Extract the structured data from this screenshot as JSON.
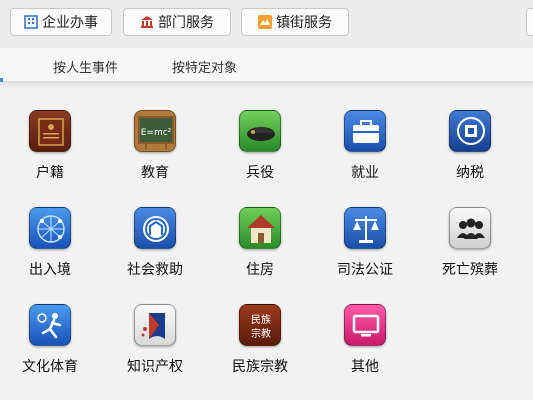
{
  "topbar": {
    "buttons": [
      {
        "label": "企业办事",
        "icon": "building-icon"
      },
      {
        "label": "部门服务",
        "icon": "government-icon"
      },
      {
        "label": "镇街服务",
        "icon": "town-icon"
      }
    ]
  },
  "tabs": [
    {
      "label": "按人生事件"
    },
    {
      "label": "按特定对象"
    }
  ],
  "grid": {
    "items": [
      {
        "label": "户籍",
        "icon": "household-register-icon",
        "color": "#6b2a1c"
      },
      {
        "label": "教育",
        "icon": "blackboard-icon",
        "color": "#3b5d3a"
      },
      {
        "label": "兵役",
        "icon": "military-beret-icon",
        "color": "#3da33a"
      },
      {
        "label": "就业",
        "icon": "briefcase-icon",
        "color": "#1f62c6"
      },
      {
        "label": "纳税",
        "icon": "tax-emblem-icon",
        "color": "#1e55b0"
      },
      {
        "label": "出入境",
        "icon": "globe-network-icon",
        "color": "#2b73d6"
      },
      {
        "label": "社会救助",
        "icon": "social-aid-icon",
        "color": "#2468c8"
      },
      {
        "label": "住房",
        "icon": "house-icon",
        "color": "#3aa03a"
      },
      {
        "label": "司法公证",
        "icon": "scales-icon",
        "color": "#1f62c6"
      },
      {
        "label": "死亡殡葬",
        "icon": "mourning-people-icon",
        "color": "#e0e0e0"
      },
      {
        "label": "文化体育",
        "icon": "sport-icon",
        "color": "#2b7fd8"
      },
      {
        "label": "知识产权",
        "icon": "intellectual-property-icon",
        "color": "#eeeeee"
      },
      {
        "label": "民族宗教",
        "icon": "ethnic-religion-icon",
        "color": "#7a2a18"
      },
      {
        "label": "其他",
        "icon": "monitor-icon",
        "color": "#e8338c"
      }
    ],
    "ethnic_icon_text": [
      "民族",
      "宗教"
    ]
  }
}
